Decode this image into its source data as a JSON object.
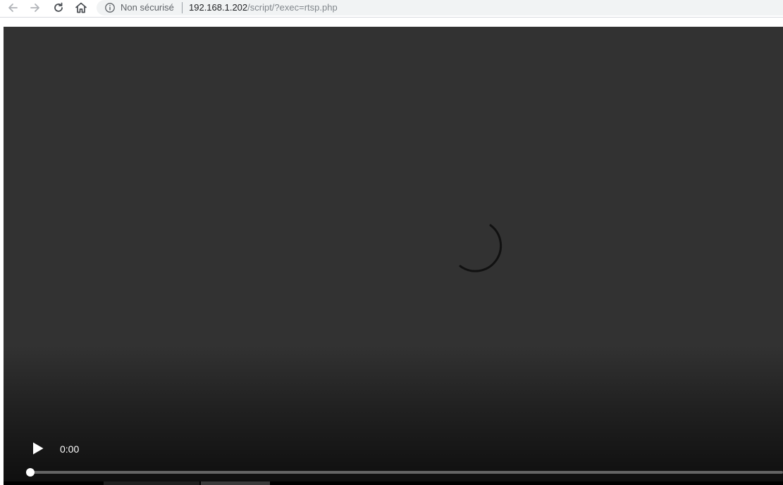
{
  "browser": {
    "security_label": "Non sécurisé",
    "url_host": "192.168.1.202",
    "url_path": "/script/?exec=rtsp.php",
    "icons": {
      "back": "arrow-left-icon",
      "forward": "arrow-right-icon",
      "reload": "reload-icon",
      "home": "home-icon",
      "info": "info-icon"
    }
  },
  "video": {
    "state": "loading",
    "current_time": "0:00",
    "progress": 0,
    "icons": {
      "play": "play-icon",
      "spinner": "loading-spinner-icon"
    }
  },
  "colors": {
    "video_background": "#323232",
    "omnibox_background": "#f1f3f4",
    "controls_text": "#ffffff"
  }
}
